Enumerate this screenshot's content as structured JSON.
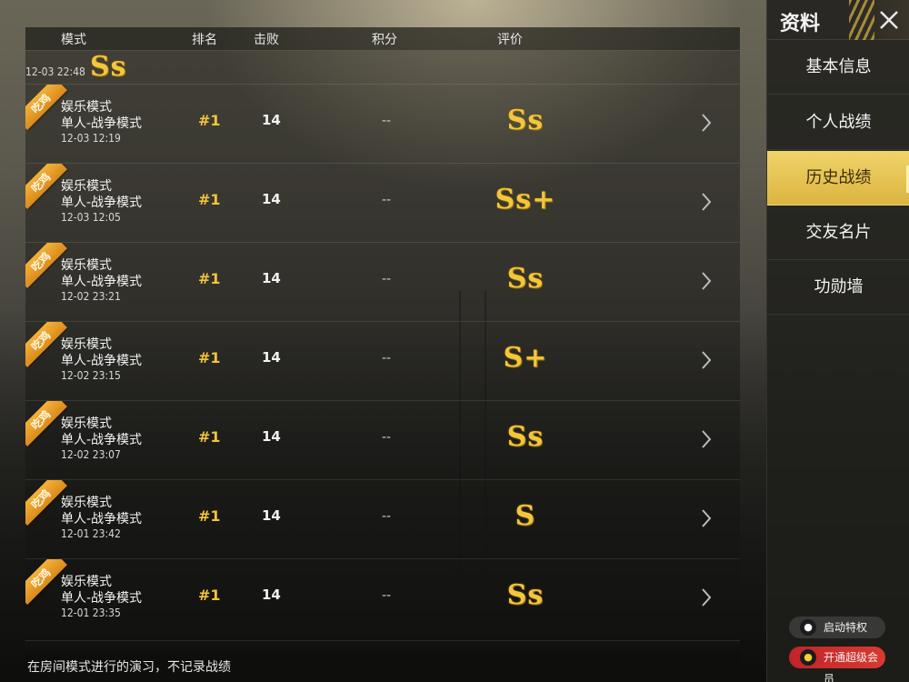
{
  "header": {
    "col_mode": "模式",
    "col_rank": "排名",
    "col_kills": "击败",
    "col_score": "积分",
    "col_rating": "评价"
  },
  "partial_top_row": {
    "time": "12-03 22:48",
    "rating": "Ss"
  },
  "matches": [
    {
      "badge": "吃鸡",
      "mode": "娱乐模式",
      "submode": "单人-战争模式",
      "time": "12-03 12:19",
      "rank": "#1",
      "kills": "14",
      "score": "--",
      "rating": "Ss"
    },
    {
      "badge": "吃鸡",
      "mode": "娱乐模式",
      "submode": "单人-战争模式",
      "time": "12-03 12:05",
      "rank": "#1",
      "kills": "14",
      "score": "--",
      "rating": "Ss+"
    },
    {
      "badge": "吃鸡",
      "mode": "娱乐模式",
      "submode": "单人-战争模式",
      "time": "12-02 23:21",
      "rank": "#1",
      "kills": "14",
      "score": "--",
      "rating": "Ss"
    },
    {
      "badge": "吃鸡",
      "mode": "娱乐模式",
      "submode": "单人-战争模式",
      "time": "12-02 23:15",
      "rank": "#1",
      "kills": "14",
      "score": "--",
      "rating": "S+"
    },
    {
      "badge": "吃鸡",
      "mode": "娱乐模式",
      "submode": "单人-战争模式",
      "time": "12-02 23:07",
      "rank": "#1",
      "kills": "14",
      "score": "--",
      "rating": "Ss"
    },
    {
      "badge": "吃鸡",
      "mode": "娱乐模式",
      "submode": "单人-战争模式",
      "time": "12-01 23:42",
      "rank": "#1",
      "kills": "14",
      "score": "--",
      "rating": "S"
    },
    {
      "badge": "吃鸡",
      "mode": "娱乐模式",
      "submode": "单人-战争模式",
      "time": "12-01 23:35",
      "rank": "#1",
      "kills": "14",
      "score": "--",
      "rating": "Ss"
    }
  ],
  "footer_note": "在房间模式进行的演习，不记录战绩",
  "sidebar": {
    "title": "资料",
    "close_icon": "close-icon",
    "items": [
      {
        "label": "基本信息",
        "active": false
      },
      {
        "label": "个人战绩",
        "active": false
      },
      {
        "label": "历史战绩",
        "active": true
      },
      {
        "label": "交友名片",
        "active": false
      },
      {
        "label": "功勋墙",
        "active": false
      }
    ],
    "privilege_button": "启动特权",
    "vip_button": "开通超级会员"
  },
  "colors": {
    "accent_gold": "#f3c63b",
    "active_tab": "#dcb440",
    "badge_orange": "#e89a25",
    "vip_red": "#c8282c"
  }
}
